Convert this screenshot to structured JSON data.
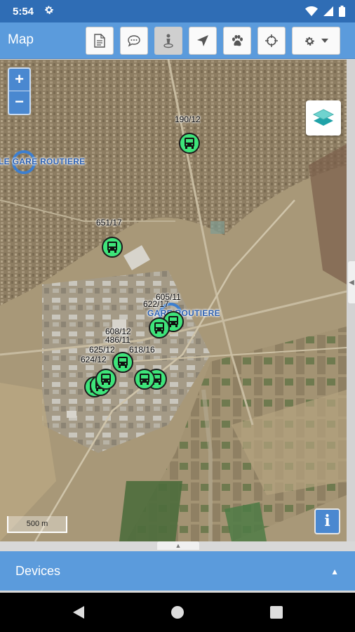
{
  "status_bar": {
    "time": "5:54",
    "icons": [
      "gear-icon",
      "wifi-icon",
      "signal-icon",
      "battery-icon"
    ]
  },
  "toolbar": {
    "title": "Map",
    "buttons": [
      "document-icon",
      "chat-icon",
      "person-pin-icon",
      "navigation-arrow-icon",
      "paw-icon",
      "crosshair-icon",
      "settings-dropdown"
    ]
  },
  "map": {
    "zoom_in": "+",
    "zoom_out": "−",
    "scale": "500 m",
    "info": "i",
    "stations": [
      {
        "label": "LE GARE ROUTIERE"
      },
      {
        "label": "GARE ROUTIERE"
      }
    ],
    "vehicles": [
      {
        "label": "190/12"
      },
      {
        "label": "651/17"
      },
      {
        "label": "605/11"
      },
      {
        "label": "622/17"
      },
      {
        "label": "608/12"
      },
      {
        "label": "486/11"
      },
      {
        "label": "625/12"
      },
      {
        "label": "618/16"
      },
      {
        "label": "624/12"
      }
    ]
  },
  "devices_panel": {
    "label": "Devices",
    "caret": "▲"
  },
  "nav": [
    "back-icon",
    "home-icon",
    "recents-icon"
  ],
  "colors": {
    "primary": "#5b9bdc",
    "status_bar": "#2f6db5",
    "marker": "#3ee47a",
    "station": "#3d7fd0"
  }
}
